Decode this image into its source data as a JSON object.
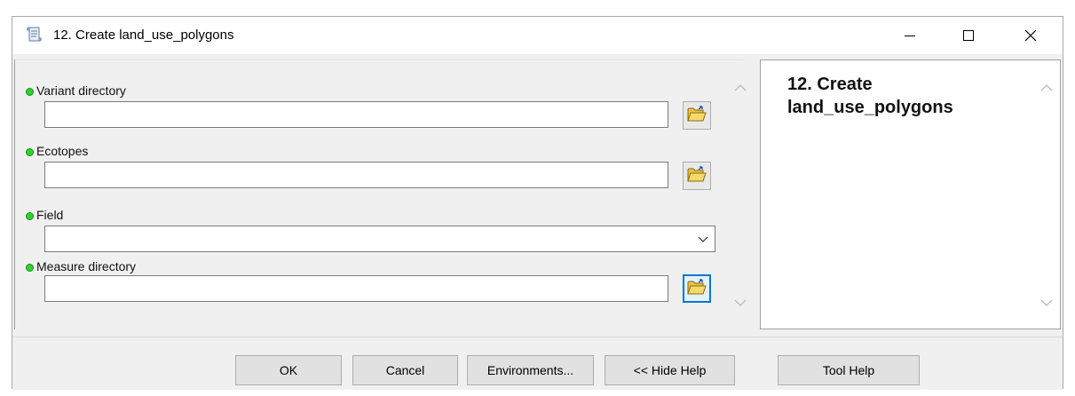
{
  "window": {
    "title": "12. Create land_use_polygons",
    "icon": "python-script-icon"
  },
  "titlebar_controls": {
    "minimize": "minimize-icon",
    "maximize": "maximize-icon",
    "close": "close-icon"
  },
  "parameters": [
    {
      "label": "Variant directory",
      "value": "",
      "type": "folder"
    },
    {
      "label": "Ecotopes",
      "value": "",
      "type": "folder"
    },
    {
      "label": "Field",
      "value": "",
      "type": "dropdown"
    },
    {
      "label": "Measure directory",
      "value": "",
      "type": "folder"
    }
  ],
  "help": {
    "title": "12. Create land_use_polygons"
  },
  "buttons": {
    "ok": "OK",
    "cancel": "Cancel",
    "environments": "Environments...",
    "hide_help": "<< Hide Help",
    "tool_help": "Tool Help"
  },
  "colors": {
    "required_dot": "#2bd52b",
    "focus_border": "#0078d7"
  }
}
